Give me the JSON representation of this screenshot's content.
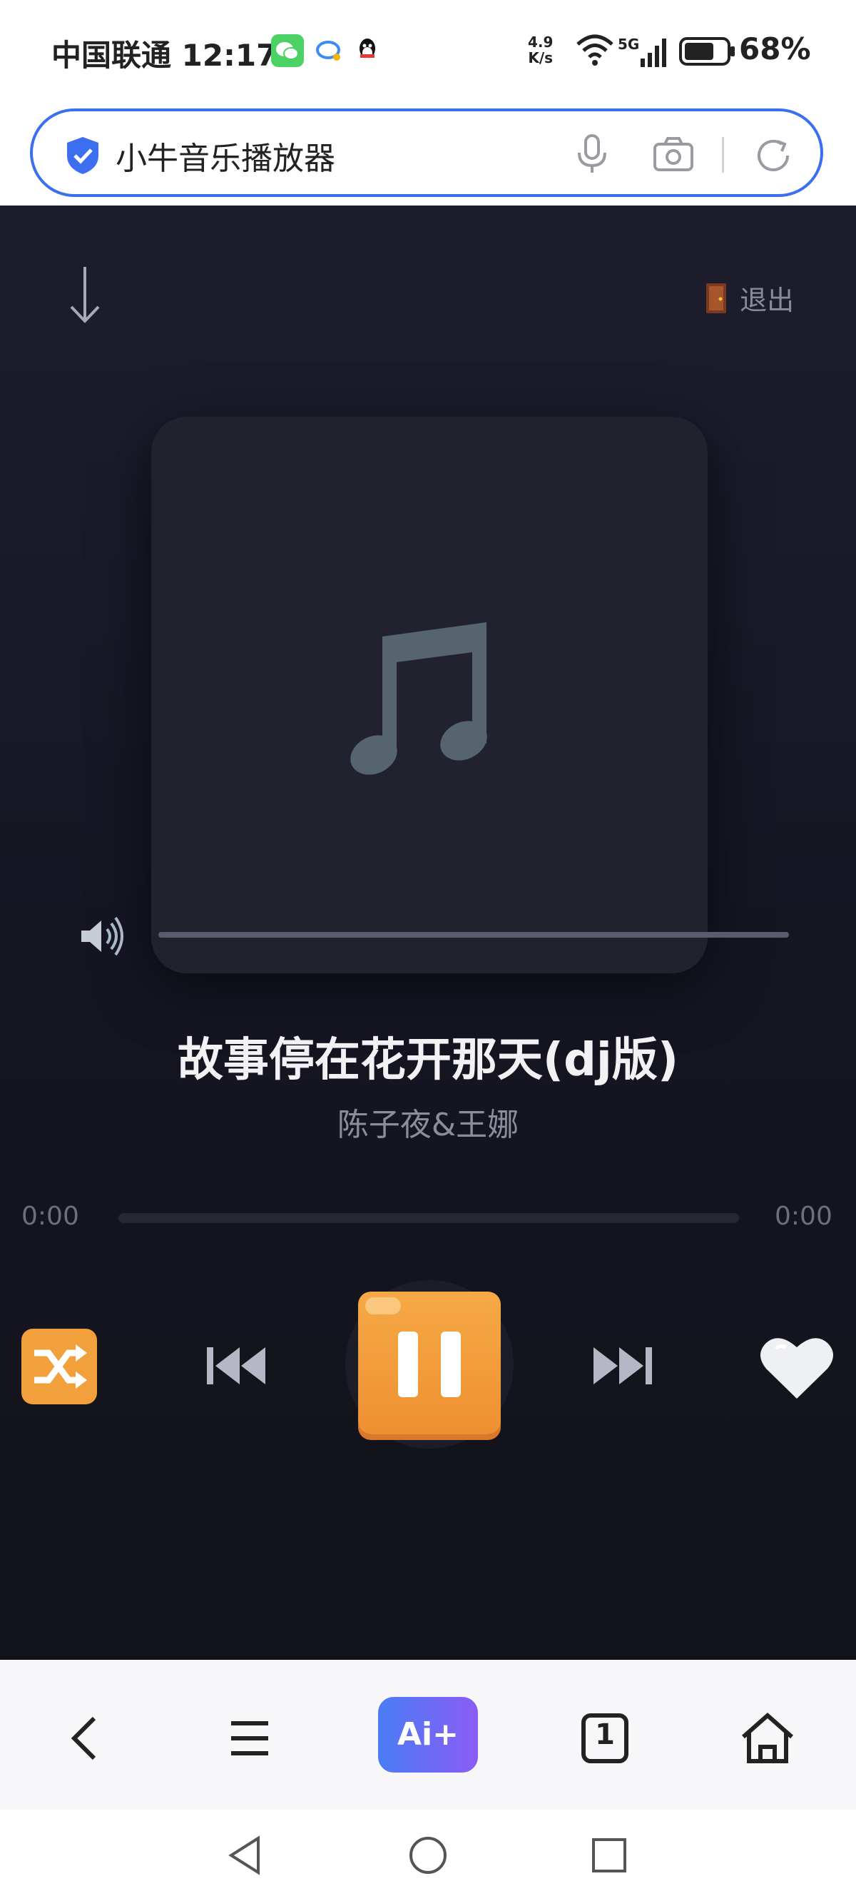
{
  "status_bar": {
    "carrier": "中国联通",
    "time": "12:17",
    "net_speed_value": "4.9",
    "net_speed_unit": "K/s",
    "signal_label": "5G",
    "battery": "68%"
  },
  "address_bar": {
    "url_text": "小牛音乐播放器"
  },
  "player": {
    "exit_label": "退出",
    "song_title": "故事停在花开那天(dj版)",
    "artist": "陈子夜&王娜",
    "time_current": "0:00",
    "time_total": "0:00",
    "progress": 0.0,
    "volume": 1.0,
    "state": "playing"
  },
  "toolbar": {
    "ai_label": "Ai+",
    "tab_count": "1"
  },
  "colors": {
    "accent_orange": "#F2A03C",
    "address_border": "#3B6FF0",
    "player_bg": "#171725"
  }
}
